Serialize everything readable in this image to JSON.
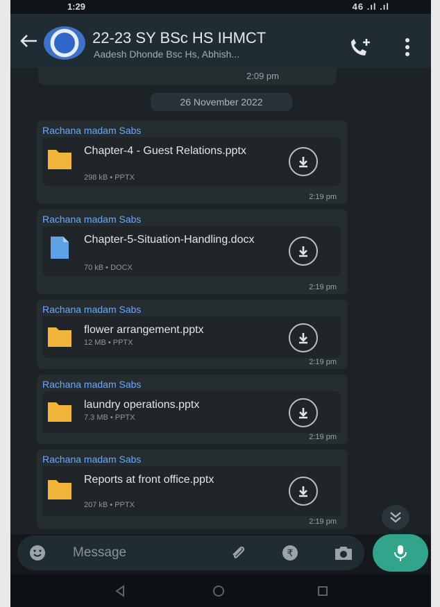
{
  "status": {
    "time": "1:29",
    "right": "46 .ıl .ıl"
  },
  "header": {
    "title": "22-23 SY BSc HS IHMCT",
    "subtitle": "Aadesh Dhonde Bsc Hs, Abhish..."
  },
  "chat": {
    "prev_time": "2:09 pm",
    "date_divider": "26 November 2022",
    "messages": [
      {
        "sender": "Rachana madam Sabs",
        "file_name": "Chapter-4 - Guest Relations.pptx",
        "file_meta": "298 kB • PPTX",
        "time": "2:19 pm",
        "file_type": "pptx"
      },
      {
        "sender": "Rachana madam Sabs",
        "file_name": "Chapter-5-Situation-Handling.docx",
        "file_meta": "70 kB • DOCX",
        "time": "2:19 pm",
        "file_type": "docx"
      },
      {
        "sender": "Rachana madam Sabs",
        "file_name": "flower arrangement.pptx",
        "file_meta": "12 MB • PPTX",
        "time": "2:19 pm",
        "file_type": "pptx"
      },
      {
        "sender": "Rachana madam Sabs",
        "file_name": "laundry operations.pptx",
        "file_meta": "7.3 MB • PPTX",
        "time": "2:19 pm",
        "file_type": "pptx"
      },
      {
        "sender": "Rachana madam Sabs",
        "file_name": "Reports at front office.pptx",
        "file_meta": "207 kB • PPTX",
        "time": "2:19 pm",
        "file_type": "pptx"
      }
    ]
  },
  "input": {
    "placeholder": "Message"
  },
  "colors": {
    "accent": "#31a48b",
    "sender": "#6ea7f7",
    "pptx": "#f0b53a",
    "docx": "#5fa3e6"
  }
}
